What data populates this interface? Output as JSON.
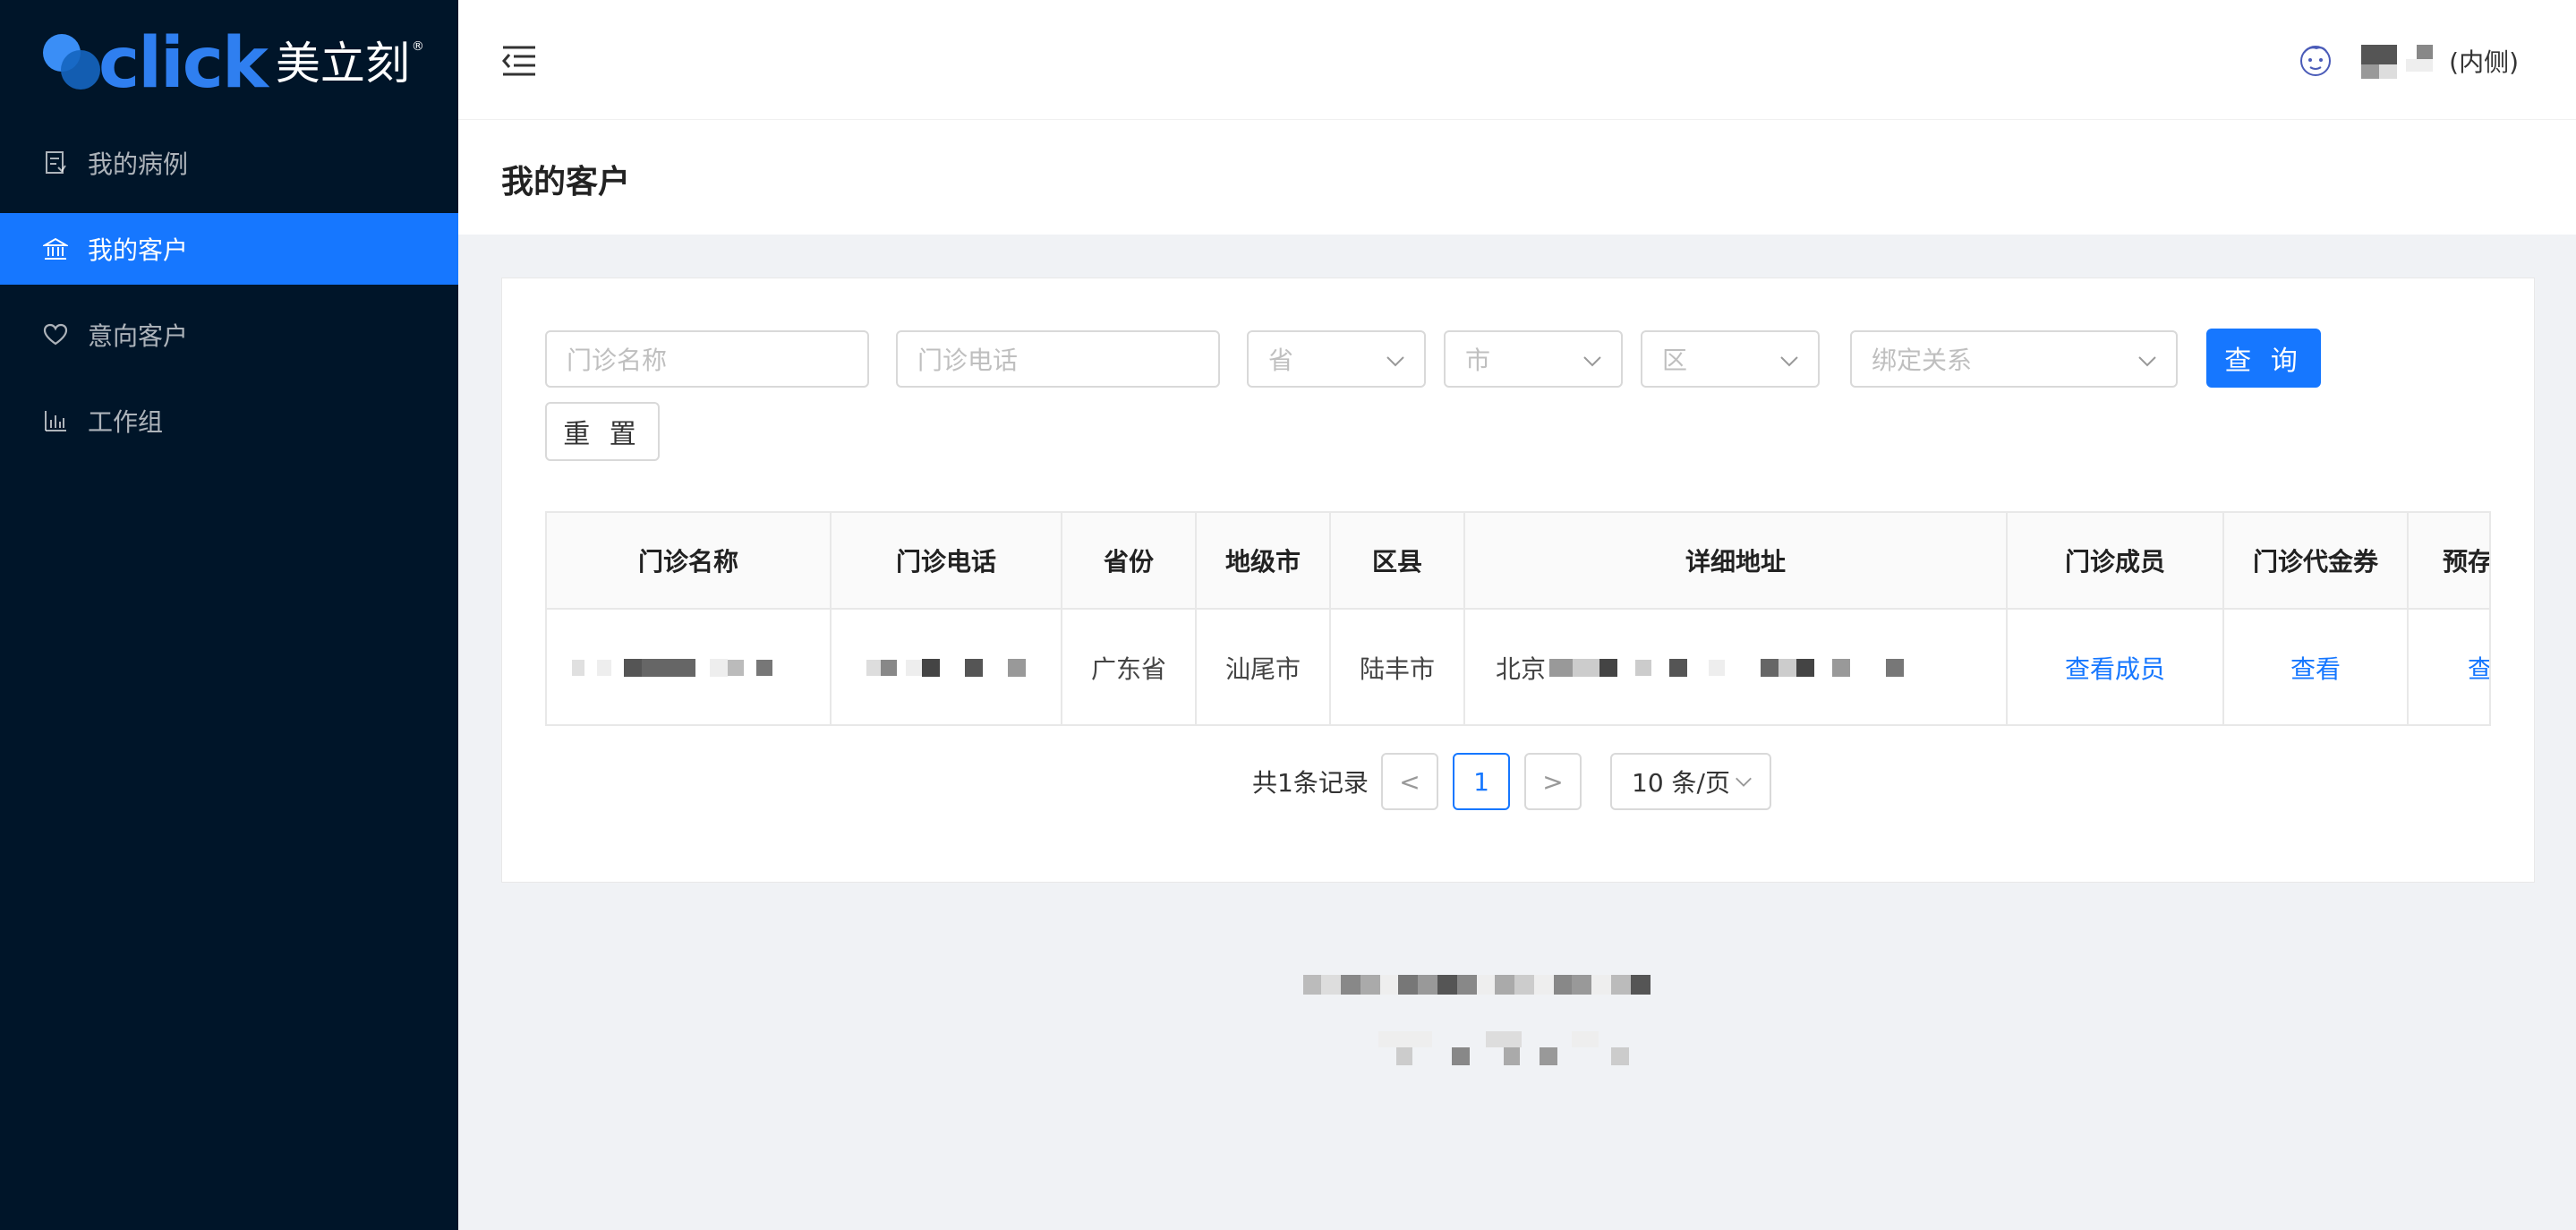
{
  "brand": {
    "logo_word": "click",
    "logo_cn": "美立刻",
    "logo_reg": "®"
  },
  "sidebar": {
    "items": [
      {
        "label": "我的病例",
        "icon": "case-file-icon",
        "active": false
      },
      {
        "label": "我的客户",
        "icon": "bank-icon",
        "active": true
      },
      {
        "label": "意向客户",
        "icon": "heart-icon",
        "active": false
      },
      {
        "label": "工作组",
        "icon": "bar-chart-icon",
        "active": false
      }
    ]
  },
  "header": {
    "user_suffix": "(内侧)"
  },
  "page": {
    "title": "我的客户"
  },
  "filters": {
    "clinic_name_placeholder": "门诊名称",
    "clinic_phone_placeholder": "门诊电话",
    "province_placeholder": "省",
    "city_placeholder": "市",
    "district_placeholder": "区",
    "binding_placeholder": "绑定关系",
    "query_label": "查 询",
    "reset_label": "重 置"
  },
  "table": {
    "columns": [
      "门诊名称",
      "门诊电话",
      "省份",
      "地级市",
      "区县",
      "详细地址",
      "门诊成员",
      "门诊代金券",
      "预存"
    ],
    "rows": [
      {
        "province": "广东省",
        "city": "汕尾市",
        "district": "陆丰市",
        "address_prefix": "北京",
        "members_link": "查看成员",
        "voucher_link": "查看",
        "prepaid_link": "查"
      }
    ]
  },
  "pagination": {
    "total_text": "共1条记录",
    "prev": "<",
    "current_page": "1",
    "next": ">",
    "page_size": "10 条/页"
  },
  "colors": {
    "sidebar_bg": "#001529",
    "accent": "#1677ff",
    "page_bg": "#f0f2f5"
  }
}
